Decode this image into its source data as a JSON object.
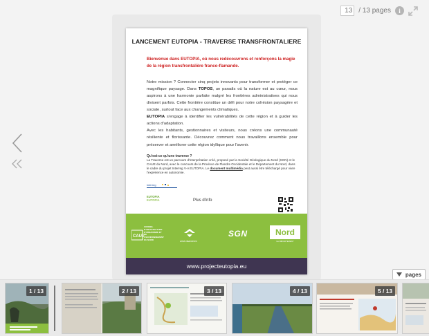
{
  "toolbar": {
    "current_page": "13",
    "page_total": "/ 13 pages",
    "info_label": "i"
  },
  "pages_button": {
    "label": "pages"
  },
  "document": {
    "title": "LANCEMENT EUTOPIA - TRAVERSE TRANSFRONTALIERE",
    "lead": "Bienvenue dans EUTOPIA, où nous redécouvrons et renforçons la magie de la région transfrontalière franco-flamande.",
    "body": {
      "p1_start": "Notre mission ? Connecter cinq projets innovants pour transformer et protéger ce magnifique paysage. Dans ",
      "p1_bold": "TOPOS",
      "p1_end": ", un paradis où la nature est au cœur, nous aspirons à une harmonie parfaite malgré les frontières administratives qui nous divisent parfois. Cette frontière constitue un défi pour notre cohésion paysagère et sociale, surtout face aux changements climatiques.",
      "p2_bold": "EUTOPIA",
      "p2_end": " s'engage à identifier les vulnérabilités de cette région et à guider les actions d'adaptation.",
      "p3": "Avec les habitants, gestionnaires et visiteurs, nous créons une communauté résiliente et florissante. Découvrez comment nous travaillons ensemble pour préserver et améliorer cette région idyllique pour l'avenir."
    },
    "small": {
      "question": "Qu'est-ce qu'une traverse ?",
      "text": "La Traverse est un parcours d'interprétation créé, proposé par la Société Géologique du Nord (SGN) et le CAUE du Nord, avec le concours de la Province de Flandre Occidentale et le Département du Nord, dans le cadre du projet Interreg V-A EUTOPIA. Le ",
      "link": "document multimédia",
      "text_end": " peut aussi être téléchargé pour vivre l'expérience en autonomie."
    },
    "logos": {
      "interreg": "interreg",
      "eutopia_1": "EUTOPIA",
      "eutopia_2": "EUTOPIA"
    },
    "plus_info": "Plus d'info",
    "partners": {
      "caue": "CAUE",
      "caue_text": "CONSEIL D'ARCHITECTURE D'URBANISME ET DE L'ENVIRONNEMENT DU NORD",
      "westv": "west-vlaanderen",
      "sgn": "SGN",
      "nord": "Nord",
      "nord_sub": "LE DÉPARTEMENT"
    },
    "footer_url": "www.projecteutopia.eu"
  },
  "thumbnails": [
    {
      "label": "1 / 13"
    },
    {
      "label": "2 / 13"
    },
    {
      "label": "3 / 13"
    },
    {
      "label": "4 / 13"
    },
    {
      "label": "5 / 13"
    },
    {
      "label": ""
    }
  ],
  "colors": {
    "accent_red": "#cc1a1a",
    "band_green": "#8cbf3f",
    "footer_purple": "#3f3551"
  }
}
